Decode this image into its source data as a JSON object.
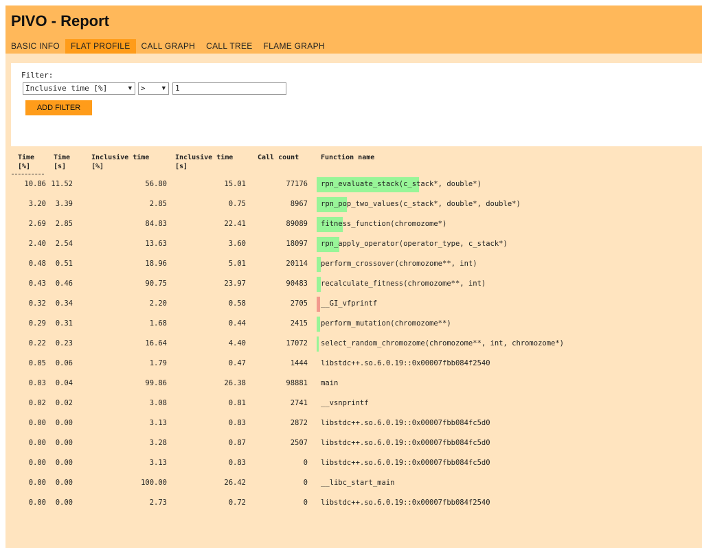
{
  "app": {
    "title": "PIVO - Report",
    "tabs": [
      "BASIC INFO",
      "FLAT PROFILE",
      "CALL GRAPH",
      "CALL TREE",
      "FLAME GRAPH"
    ],
    "active_tab": "FLAT PROFILE"
  },
  "filter": {
    "label": "Filter:",
    "column_select": "Inclusive time [%]",
    "operator_select": ">",
    "value": "1",
    "add_button": "ADD FILTER"
  },
  "table": {
    "headers": {
      "time_pct": [
        "Time",
        "[%]"
      ],
      "time_s": [
        "Time",
        "[s]"
      ],
      "incl_pct": [
        "Inclusive time",
        "[%]"
      ],
      "incl_s": [
        "Inclusive time",
        "[s]"
      ],
      "call_count": "Call count",
      "function_name": "Function name"
    },
    "rows": [
      {
        "time_pct": "10.86",
        "time_s": "11.52",
        "incl_pct": "56.80",
        "incl_s": "15.01",
        "calls": "77176",
        "name": "rpn_evaluate_stack(c_stack*, double*)",
        "bar_fraction": 0.99,
        "bar_color": "#98f598"
      },
      {
        "time_pct": "3.20",
        "time_s": "3.39",
        "incl_pct": "2.85",
        "incl_s": "0.75",
        "calls": "8967",
        "name": "rpn_pop_two_values(c_stack*, double*, double*)",
        "bar_fraction": 0.29,
        "bar_color": "#98f598"
      },
      {
        "time_pct": "2.69",
        "time_s": "2.85",
        "incl_pct": "84.83",
        "incl_s": "22.41",
        "calls": "89089",
        "name": "fitness_function(chromozome*)",
        "bar_fraction": 0.25,
        "bar_color": "#98f598"
      },
      {
        "time_pct": "2.40",
        "time_s": "2.54",
        "incl_pct": "13.63",
        "incl_s": "3.60",
        "calls": "18097",
        "name": "rpn_apply_operator(operator_type, c_stack*)",
        "bar_fraction": 0.22,
        "bar_color": "#98f598"
      },
      {
        "time_pct": "0.48",
        "time_s": "0.51",
        "incl_pct": "18.96",
        "incl_s": "5.01",
        "calls": "20114",
        "name": "perform_crossover(chromozome**, int)",
        "bar_fraction": 0.04,
        "bar_color": "#98f598"
      },
      {
        "time_pct": "0.43",
        "time_s": "0.46",
        "incl_pct": "90.75",
        "incl_s": "23.97",
        "calls": "90483",
        "name": "recalculate_fitness(chromozome**, int)",
        "bar_fraction": 0.04,
        "bar_color": "#98f598"
      },
      {
        "time_pct": "0.32",
        "time_s": "0.34",
        "incl_pct": "2.20",
        "incl_s": "0.58",
        "calls": "2705",
        "name": "__GI_vfprintf",
        "bar_fraction": 0.03,
        "bar_color": "#f29a8e"
      },
      {
        "time_pct": "0.29",
        "time_s": "0.31",
        "incl_pct": "1.68",
        "incl_s": "0.44",
        "calls": "2415",
        "name": "perform_mutation(chromozome**)",
        "bar_fraction": 0.03,
        "bar_color": "#98f598"
      },
      {
        "time_pct": "0.22",
        "time_s": "0.23",
        "incl_pct": "16.64",
        "incl_s": "4.40",
        "calls": "17072",
        "name": "select_random_chromozome(chromozome**, int, chromozome*)",
        "bar_fraction": 0.02,
        "bar_color": "#98f598"
      },
      {
        "time_pct": "0.05",
        "time_s": "0.06",
        "incl_pct": "1.79",
        "incl_s": "0.47",
        "calls": "1444",
        "name": "libstdc++.so.6.0.19::0x00007fbb084f2540",
        "bar_fraction": 0,
        "bar_color": "#98f598"
      },
      {
        "time_pct": "0.03",
        "time_s": "0.04",
        "incl_pct": "99.86",
        "incl_s": "26.38",
        "calls": "98881",
        "name": "main",
        "bar_fraction": 0,
        "bar_color": "#98f598"
      },
      {
        "time_pct": "0.02",
        "time_s": "0.02",
        "incl_pct": "3.08",
        "incl_s": "0.81",
        "calls": "2741",
        "name": "__vsnprintf",
        "bar_fraction": 0,
        "bar_color": "#98f598"
      },
      {
        "time_pct": "0.00",
        "time_s": "0.00",
        "incl_pct": "3.13",
        "incl_s": "0.83",
        "calls": "2872",
        "name": "libstdc++.so.6.0.19::0x00007fbb084fc5d0",
        "bar_fraction": 0,
        "bar_color": "#98f598"
      },
      {
        "time_pct": "0.00",
        "time_s": "0.00",
        "incl_pct": "3.28",
        "incl_s": "0.87",
        "calls": "2507",
        "name": "libstdc++.so.6.0.19::0x00007fbb084fc5d0",
        "bar_fraction": 0,
        "bar_color": "#98f598"
      },
      {
        "time_pct": "0.00",
        "time_s": "0.00",
        "incl_pct": "3.13",
        "incl_s": "0.83",
        "calls": "0",
        "name": "libstdc++.so.6.0.19::0x00007fbb084fc5d0",
        "bar_fraction": 0,
        "bar_color": "#98f598"
      },
      {
        "time_pct": "0.00",
        "time_s": "0.00",
        "incl_pct": "100.00",
        "incl_s": "26.42",
        "calls": "0",
        "name": "__libc_start_main",
        "bar_fraction": 0,
        "bar_color": "#98f598"
      },
      {
        "time_pct": "0.00",
        "time_s": "0.00",
        "incl_pct": "2.73",
        "incl_s": "0.72",
        "calls": "0",
        "name": "libstdc++.so.6.0.19::0x00007fbb084f2540",
        "bar_fraction": 0,
        "bar_color": "#98f598"
      }
    ]
  }
}
